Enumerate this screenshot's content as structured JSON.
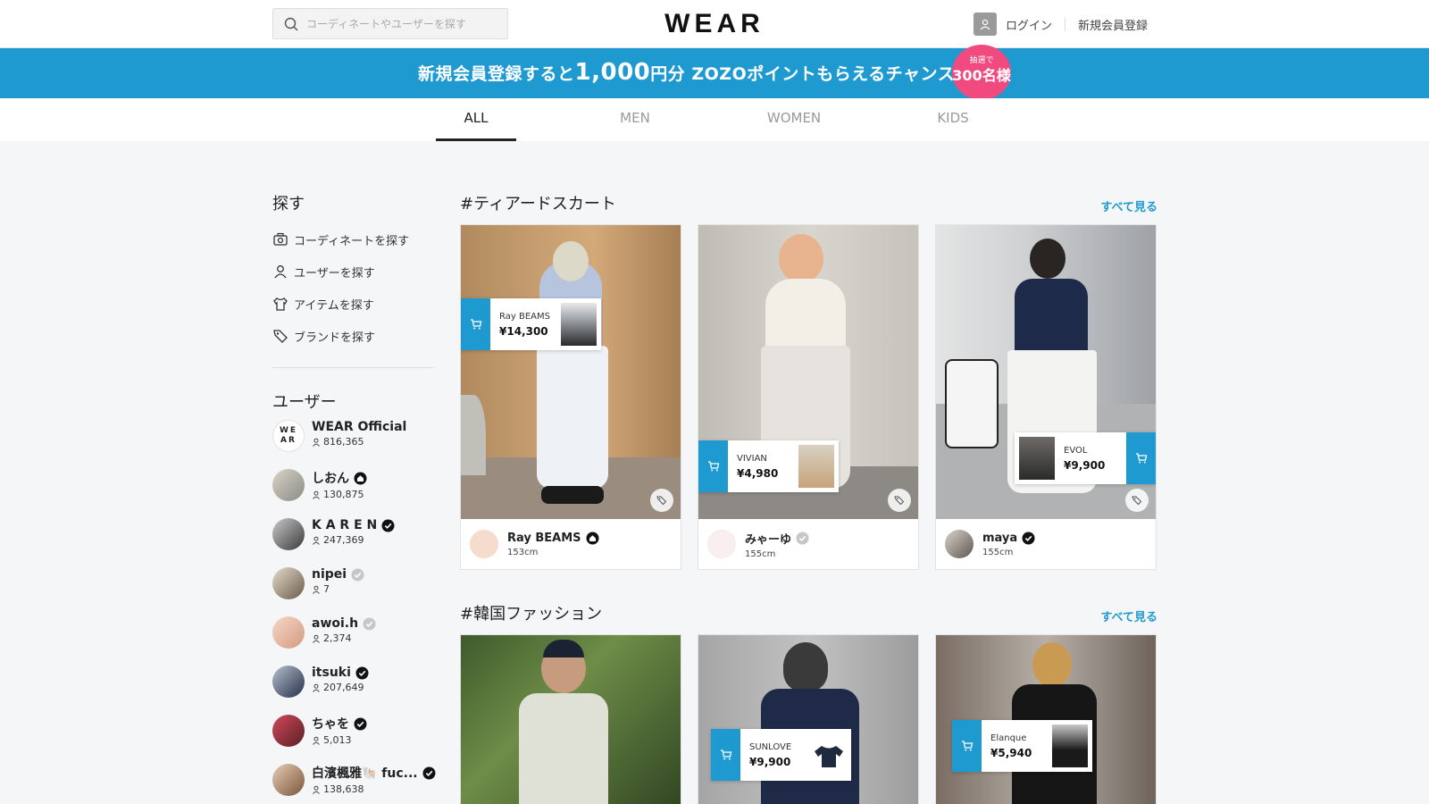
{
  "header": {
    "search_placeholder": "コーディネートやユーザーを探す",
    "logo": "WEAR",
    "login": "ログイン",
    "signup": "新規会員登録"
  },
  "banner": {
    "text_pre": "新規会員登録すると",
    "amount": "1,000",
    "text_post": "円分 ZOZOポイントもらえるチャンス",
    "lottery_small": "抽選で",
    "lottery_num": "300名様"
  },
  "tabs": [
    "ALL",
    "MEN",
    "WOMEN",
    "KIDS"
  ],
  "sidebar": {
    "explore_title": "探す",
    "explore_items": [
      "コーディネートを探す",
      "ユーザーを探す",
      "アイテムを探す",
      "ブランドを探す"
    ],
    "users_title": "ユーザー",
    "users": [
      {
        "name": "WEAR Official",
        "followers": "816,365",
        "badge": "none",
        "avatar_text": "WE AR"
      },
      {
        "name": "しおん",
        "followers": "130,875",
        "badge": "shop"
      },
      {
        "name": "K A R E N",
        "followers": "247,369",
        "badge": "verified"
      },
      {
        "name": "nipei",
        "followers": "7",
        "badge": "gray"
      },
      {
        "name": "awoi.h",
        "followers": "2,374",
        "badge": "gray"
      },
      {
        "name": "itsuki",
        "followers": "207,649",
        "badge": "verified"
      },
      {
        "name": "ちゃを",
        "followers": "5,013",
        "badge": "verified"
      },
      {
        "name": "白濱楓雅🐚 fuc...",
        "followers": "138,638",
        "badge": "verified"
      }
    ]
  },
  "sections": [
    {
      "title": "#ティアードスカート",
      "see_all": "すべて見る",
      "cards": [
        {
          "user": "Ray BEAMS",
          "height": "153cm",
          "badge": "shop",
          "item_brand": "Ray BEAMS",
          "item_price": "¥14,300"
        },
        {
          "user": "みゃーゆ",
          "height": "155cm",
          "badge": "gray",
          "item_brand": "VIVIAN",
          "item_price": "¥4,980"
        },
        {
          "user": "maya",
          "height": "155cm",
          "badge": "verified",
          "item_brand": "EVOL",
          "item_price": "¥9,900"
        }
      ]
    },
    {
      "title": "#韓国ファッション",
      "see_all": "すべて見る",
      "cards": [
        {
          "item_brand": "",
          "item_price": ""
        },
        {
          "item_brand": "SUNLOVE",
          "item_price": "¥9,900"
        },
        {
          "item_brand": "Elanque",
          "item_price": "¥5,940"
        }
      ]
    }
  ],
  "colors": {
    "accent": "#1f9ad1",
    "banner": "#1f9ad1",
    "lottery": "#f04a7e"
  }
}
